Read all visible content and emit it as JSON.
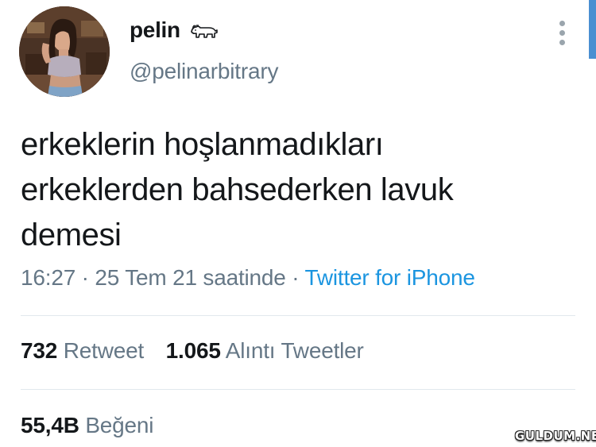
{
  "profile": {
    "display_name": "pelin",
    "name_icon": "lion-emoji-icon",
    "handle": "@pelinarbitrary",
    "avatar": "profile-photo"
  },
  "tweet": {
    "lines": [
      "erkeklerin hoşlanmadıkları",
      "erkeklerden bahsederken lavuk",
      "demesi"
    ],
    "time": "16:27",
    "separator": "·",
    "date": "25 Tem 21 saatinde",
    "source": "Twitter for iPhone"
  },
  "stats": {
    "retweets_count": "732",
    "retweets_label": "Retweet",
    "quotes_count": "1.065",
    "quotes_label": "Alıntı Tweetler",
    "likes_count": "55,4B",
    "likes_label": "Beğeni"
  },
  "more_icon": "more-vertical-icon",
  "watermark": "GULDUM.NET",
  "colors": {
    "text": "#14171a",
    "secondary": "#657786",
    "link": "#1b95e0",
    "divider": "#e1e8ed"
  }
}
